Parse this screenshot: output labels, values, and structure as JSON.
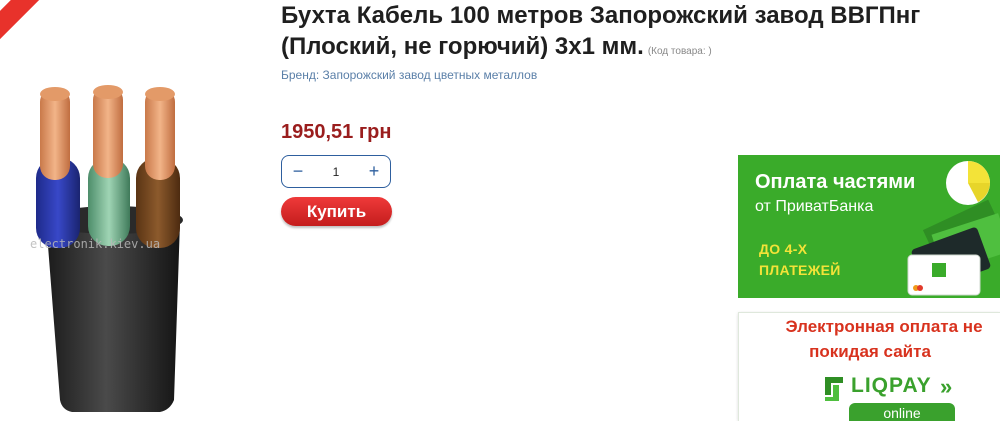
{
  "product": {
    "title_line1": "Бухта Кабель 100 метров Запорожский завод ВВГПнг",
    "title_line2": "(Плоский, не горючий) 3х1 мм.",
    "code_note": "(Код товара: )",
    "brand": "Бренд: Запорожский завод цветных металлов",
    "price": "1950,51 грн",
    "watermark": "electronik.kiev.ua"
  },
  "quantity": {
    "value": "1",
    "minus": "−",
    "plus": "+"
  },
  "buy_button": "Купить",
  "banner_privat": {
    "title": "Оплата частями",
    "subtitle": "от ПриватБанка",
    "payments_line1": "ДО 4-Х",
    "payments_line2": "ПЛАТЕЖЕЙ"
  },
  "banner_liqpay": {
    "line1": "Электронная оплата не",
    "line2": "покидая сайта",
    "logo": "LIQPAY",
    "chevrons": "»",
    "online": "online"
  },
  "colors": {
    "price": "#9a1d1d",
    "buy": "#d42626",
    "privat_green": "#3aab2a",
    "liqpay_red": "#d8321e"
  }
}
